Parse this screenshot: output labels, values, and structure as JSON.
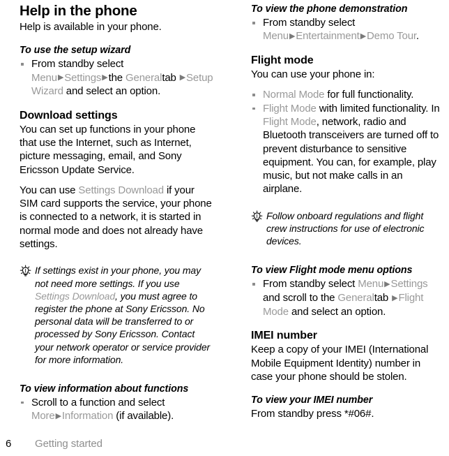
{
  "document": {
    "footer": {
      "page_number": "6",
      "section_label": "Getting started"
    }
  },
  "left_column": {
    "chapter_title": "Help in the phone",
    "intro_text": "Help is available in your phone.",
    "proc1": {
      "title": "To use the setup wizard",
      "bullet": {
        "t1": "From standby select ",
        "ui1": "Menu",
        "a1": "▶",
        "ui2": "Settings",
        "a2": "▶",
        "t2": "the ",
        "ui3": "General",
        "t3": "tab ",
        "a3": "▶",
        "ui4": "Setup Wizard",
        "t4": " and select an option."
      }
    },
    "section1": {
      "title": "Download settings",
      "para1": "You can set up functions in your phone that use the Internet, such as Internet, picture messaging, email, and Sony Ericsson Update Service.",
      "para2_a": "You can use ",
      "para2_ui": "Settings Download",
      "para2_b": " if your SIM card supports the service, your phone is connected to a network, it is started in normal mode and does not already have settings."
    },
    "note1": {
      "icon": "lightbulb-tip-icon",
      "a": "If settings exist in your phone, you may not need more settings. If you use ",
      "ui": "Settings Download",
      "b": ", you must agree to register the phone at Sony Ericsson. No personal data will be transferred to or processed by Sony Ericsson. Contact your network operator or service provider for more information."
    },
    "proc2": {
      "title": "To view information about functions",
      "bullet": {
        "t1": "Scroll to a function and select ",
        "ui1": "More",
        "a1": "▶",
        "ui2": "Information",
        "t2": " (if available)."
      }
    }
  },
  "right_column": {
    "proc1": {
      "title": "To view the phone demonstration",
      "bullet": {
        "t1": "From standby select ",
        "ui1": "Menu",
        "a1": "▶",
        "ui2": "Entertainment",
        "a2": "▶",
        "ui3": "Demo Tour",
        "t2": "."
      }
    },
    "section_flight": {
      "title": "Flight mode",
      "intro": "You can use your phone in:",
      "bullet1": {
        "ui1": "Normal Mode",
        "t1": " for full functionality."
      },
      "bullet2": {
        "ui1": "Flight Mode",
        "t1": " with limited functionality. In ",
        "ui2": "Flight Mode",
        "t2": ", network, radio and Bluetooth transceivers are turned off to prevent disturbance to sensitive equipment. You can, for example, play music, but not make calls in an airplane."
      }
    },
    "note1": {
      "icon": "lightbulb-tip-icon",
      "text": "Follow onboard regulations and flight crew instructions for use of electronic devices."
    },
    "proc2": {
      "title": "To view Flight mode menu options",
      "bullet": {
        "t1": "From standby select ",
        "ui1": "Menu",
        "a1": "▶",
        "ui2": "Settings",
        "t2": " and scroll to the ",
        "ui3": "General",
        "t3": "tab ",
        "a2": "▶",
        "ui4": "Flight Mode",
        "t4": " and select an option."
      }
    },
    "section_imei": {
      "title": "IMEI number",
      "para1": "Keep a copy of your IMEI (International Mobile Equipment Identity) number in case your phone should be stolen.",
      "proc_title": "To view your IMEI number",
      "proc_text": "From standby press *#06#."
    }
  },
  "colors": {
    "ui_path_gray": "#999999",
    "body_black": "#000000",
    "footer_gray": "#8e8e8e",
    "bullet_gray": "#8c8c8c"
  }
}
